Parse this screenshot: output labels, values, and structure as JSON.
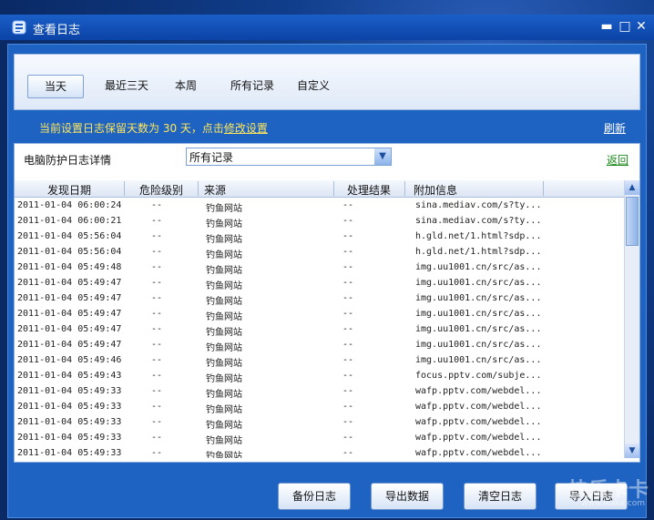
{
  "window": {
    "title": "查看日志"
  },
  "tabs": [
    {
      "label": "当天",
      "active": true
    },
    {
      "label": "最近三天",
      "active": false
    },
    {
      "label": "本周",
      "active": false
    },
    {
      "label": "所有记录",
      "active": false
    },
    {
      "label": "自定义",
      "active": false
    }
  ],
  "notice": {
    "text": "当前设置日志保留天数为 30 天，点击",
    "link": "修改设置",
    "color": "#ffe65a"
  },
  "refresh_label": "刷新",
  "filter": {
    "label": "电脑防护日志详情",
    "selected": "所有记录",
    "back_label": "返回"
  },
  "columns": [
    "发现日期",
    "危险级别",
    "来源",
    "处理结果",
    "附加信息"
  ],
  "rows": [
    [
      "2011-01-04 06:00:24",
      "--",
      "钓鱼网站",
      "--",
      "sina.mediav.com/s?ty..."
    ],
    [
      "2011-01-04 06:00:21",
      "--",
      "钓鱼网站",
      "--",
      "sina.mediav.com/s?ty..."
    ],
    [
      "2011-01-04 05:56:04",
      "--",
      "钓鱼网站",
      "--",
      "h.gld.net/1.html?sdp..."
    ],
    [
      "2011-01-04 05:56:04",
      "--",
      "钓鱼网站",
      "--",
      "h.gld.net/1.html?sdp..."
    ],
    [
      "2011-01-04 05:49:48",
      "--",
      "钓鱼网站",
      "--",
      "img.uu1001.cn/src/as..."
    ],
    [
      "2011-01-04 05:49:47",
      "--",
      "钓鱼网站",
      "--",
      "img.uu1001.cn/src/as..."
    ],
    [
      "2011-01-04 05:49:47",
      "--",
      "钓鱼网站",
      "--",
      "img.uu1001.cn/src/as..."
    ],
    [
      "2011-01-04 05:49:47",
      "--",
      "钓鱼网站",
      "--",
      "img.uu1001.cn/src/as..."
    ],
    [
      "2011-01-04 05:49:47",
      "--",
      "钓鱼网站",
      "--",
      "img.uu1001.cn/src/as..."
    ],
    [
      "2011-01-04 05:49:47",
      "--",
      "钓鱼网站",
      "--",
      "img.uu1001.cn/src/as..."
    ],
    [
      "2011-01-04 05:49:46",
      "--",
      "钓鱼网站",
      "--",
      "img.uu1001.cn/src/as..."
    ],
    [
      "2011-01-04 05:49:43",
      "--",
      "钓鱼网站",
      "--",
      "focus.pptv.com/subje..."
    ],
    [
      "2011-01-04 05:49:33",
      "--",
      "钓鱼网站",
      "--",
      "wafp.pptv.com/webdel..."
    ],
    [
      "2011-01-04 05:49:33",
      "--",
      "钓鱼网站",
      "--",
      "wafp.pptv.com/webdel..."
    ],
    [
      "2011-01-04 05:49:33",
      "--",
      "钓鱼网站",
      "--",
      "wafp.pptv.com/webdel..."
    ],
    [
      "2011-01-04 05:49:33",
      "--",
      "钓鱼网站",
      "--",
      "wafp.pptv.com/webdel..."
    ],
    [
      "2011-01-04 05:49:33",
      "--",
      "钓鱼网站",
      "--",
      "wafp.pptv.com/webdel..."
    ]
  ],
  "buttons": {
    "backup": "备份日志",
    "export": "导出数据",
    "clear": "清空日志",
    "import": "导入日志"
  },
  "watermark": {
    "text": "快乐卡卡",
    "url": "www.ikaka.com"
  }
}
